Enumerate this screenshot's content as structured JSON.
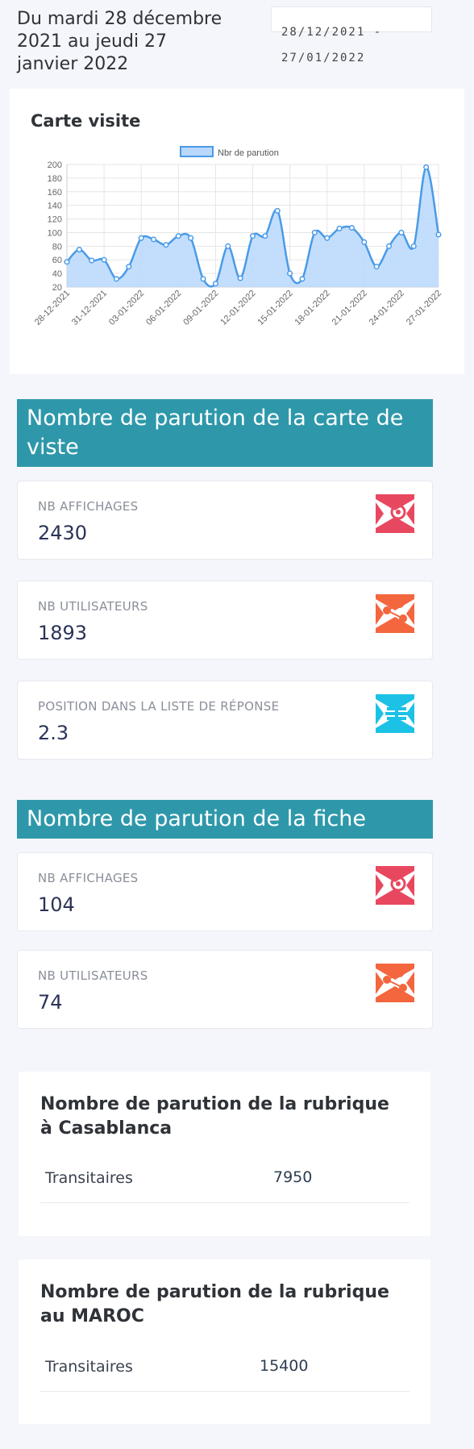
{
  "header": {
    "date_range_text": "Du mardi 28 décembre 2021 au jeudi 27 janvier 2022",
    "date_input_value": "28/12/2021 - 27/01/2022"
  },
  "visit_chart": {
    "title": "Carte visite",
    "icon_legend_color": "#4a9be8"
  },
  "chart_data": {
    "type": "area",
    "title": "",
    "legend": [
      "Nbr de parution"
    ],
    "legend_position": "top",
    "ylim": [
      20,
      200
    ],
    "yticks": [
      20,
      40,
      60,
      80,
      100,
      120,
      140,
      160,
      180,
      200
    ],
    "grid": true,
    "x_tick_labels": [
      "28-12-2021",
      "31-12-2021",
      "03-01-2022",
      "06-01-2022",
      "09-01-2022",
      "12-01-2022",
      "15-01-2022",
      "18-01-2022",
      "21-01-2022",
      "24-01-2022",
      "27-01-2022"
    ],
    "x": [
      "28-12-2021",
      "29-12-2021",
      "30-12-2021",
      "31-12-2021",
      "01-01-2022",
      "02-01-2022",
      "03-01-2022",
      "04-01-2022",
      "05-01-2022",
      "06-01-2022",
      "07-01-2022",
      "08-01-2022",
      "09-01-2022",
      "10-01-2022",
      "11-01-2022",
      "12-01-2022",
      "13-01-2022",
      "14-01-2022",
      "15-01-2022",
      "16-01-2022",
      "17-01-2022",
      "18-01-2022",
      "19-01-2022",
      "20-01-2022",
      "21-01-2022",
      "22-01-2022",
      "23-01-2022",
      "24-01-2022",
      "25-01-2022",
      "26-01-2022",
      "27-01-2022"
    ],
    "series": [
      {
        "name": "Nbr de parution",
        "color": "#4a9be8",
        "fill": "#b9d8fb",
        "values": [
          57,
          75,
          59,
          60,
          32,
          50,
          92,
          90,
          82,
          95,
          92,
          32,
          25,
          80,
          33,
          95,
          95,
          132,
          40,
          32,
          100,
          92,
          106,
          107,
          86,
          50,
          80,
          100,
          80,
          196,
          97
        ]
      }
    ]
  },
  "section_carte": {
    "title": "Nombre de parution de la carte de viste"
  },
  "carte_stats": [
    {
      "label": "NB AFFICHAGES",
      "value": "2430",
      "icon": "eye-icon",
      "color": "#e8485f"
    },
    {
      "label": "NB UTILISATEURS",
      "value": "1893",
      "icon": "users-network-icon",
      "color": "#f3663e"
    },
    {
      "label": "POSITION DANS LA LISTE DE RÉPONSE",
      "value": "2.3",
      "icon": "list-position-icon",
      "color": "#1cc2e6"
    }
  ],
  "section_fiche": {
    "title": "Nombre de parution de la fiche"
  },
  "fiche_stats": [
    {
      "label": "NB AFFICHAGES",
      "value": "104",
      "icon": "eye-icon",
      "color": "#e8485f"
    },
    {
      "label": "NB UTILISATEURS",
      "value": "74",
      "icon": "users-network-icon",
      "color": "#f3663e"
    }
  ],
  "rubrique_casablanca": {
    "title": "Nombre de parution de la rubrique à Casablanca",
    "rows": [
      {
        "label": "Transitaires",
        "value": "7950"
      }
    ]
  },
  "rubrique_maroc": {
    "title": "Nombre de parution de la rubrique au MAROC",
    "rows": [
      {
        "label": "Transitaires",
        "value": "15400"
      }
    ]
  }
}
